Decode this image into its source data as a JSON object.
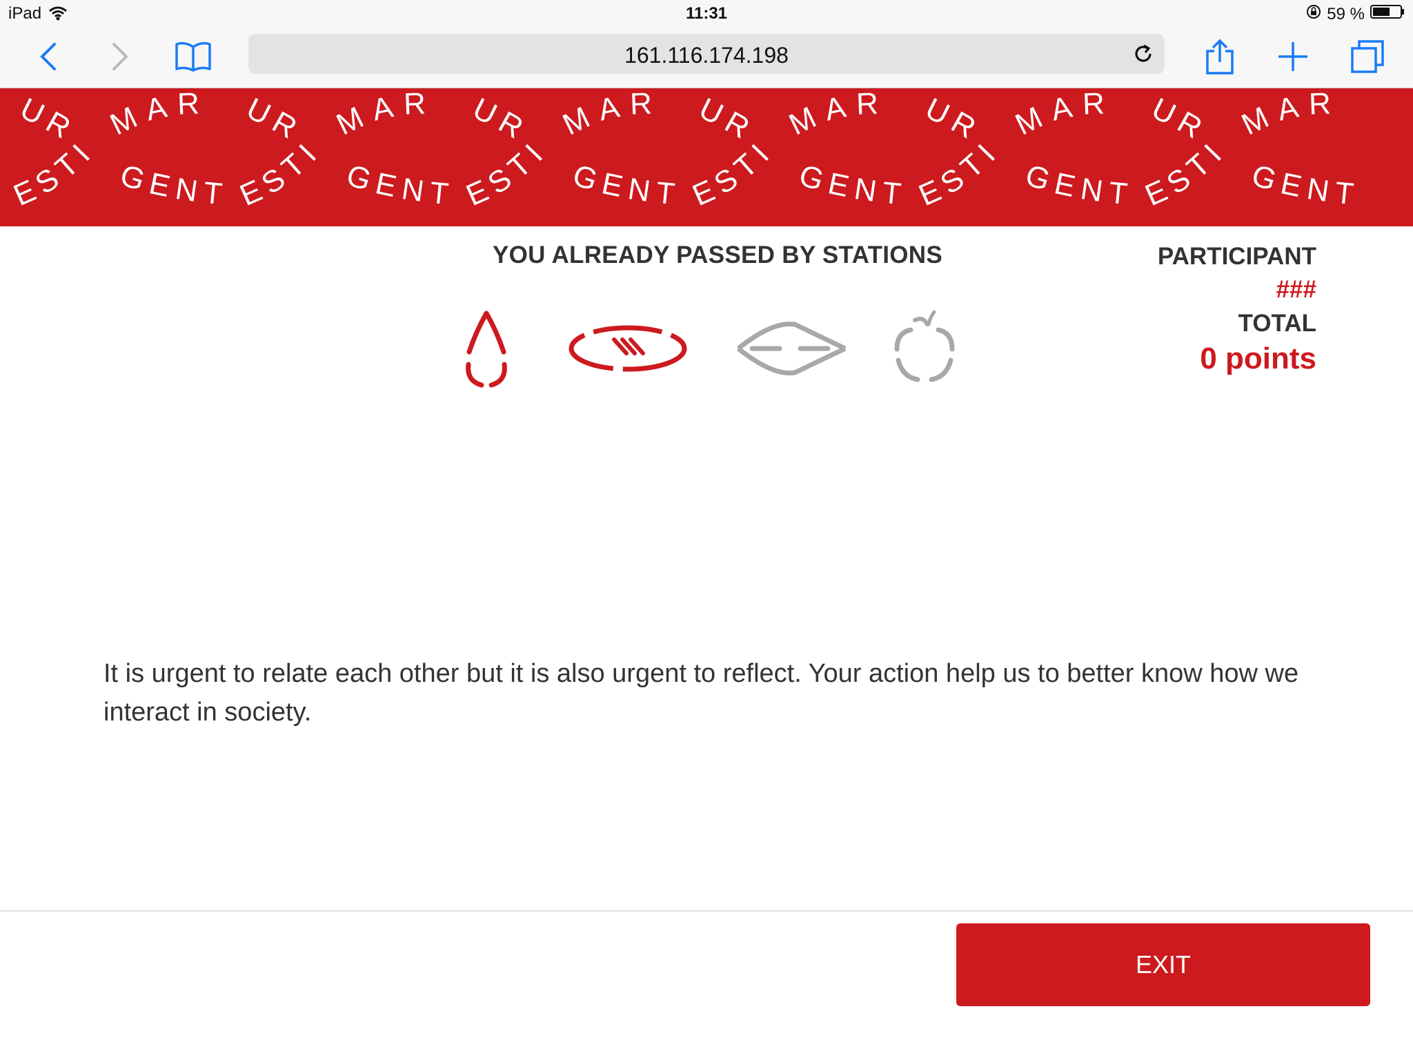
{
  "status_bar": {
    "device": "iPad",
    "time": "11:31",
    "battery": "59 %",
    "icons": [
      "wifi-icon",
      "rotation-lock-icon",
      "battery-icon"
    ]
  },
  "browser": {
    "url": "161.116.174.198",
    "icons": [
      "back-icon",
      "forward-icon",
      "bookmarks-icon",
      "reload-icon",
      "share-icon",
      "new-tab-icon",
      "tabs-icon"
    ]
  },
  "banner": {
    "tiles": [
      {
        "top_arc": "UR",
        "middle_arc": "MAR",
        "bottom_left": "ESTI",
        "bottom_right": "GENT"
      },
      {
        "top_arc": "UR",
        "middle_arc": "MAR",
        "bottom_left": "ESTI",
        "bottom_right": "GENT"
      },
      {
        "top_arc": "UR",
        "middle_arc": "MAR",
        "bottom_left": "ESTI",
        "bottom_right": "GENT"
      },
      {
        "top_arc": "UR",
        "middle_arc": "MAR",
        "bottom_left": "ESTI",
        "bottom_right": "GENT"
      },
      {
        "top_arc": "UR",
        "middle_arc": "MAR",
        "bottom_left": "ESTI",
        "bottom_right": "GENT"
      },
      {
        "top_arc": "UR",
        "middle_arc": "MAR",
        "bottom_left": "ESTI",
        "bottom_right": "GENT"
      }
    ],
    "color": "#cc1a1e"
  },
  "stations": {
    "heading": "YOU ALREADY PASSED BY STATIONS",
    "items": [
      {
        "icon": "blood-drop-icon",
        "passed": true
      },
      {
        "icon": "mouth-icon",
        "passed": true
      },
      {
        "icon": "eye-icon",
        "passed": false
      },
      {
        "icon": "apple-icon",
        "passed": false
      }
    ],
    "passed_color": "#cc1a1e",
    "pending_color": "#a8a8a8"
  },
  "participant": {
    "label": "PARTICIPANT",
    "id": "###",
    "total_label": "TOTAL",
    "points": "0 points"
  },
  "message": "It is urgent to relate each other but it is also urgent to reflect. Your action help us to better know how we interact in society.",
  "exit_label": "EXIT"
}
